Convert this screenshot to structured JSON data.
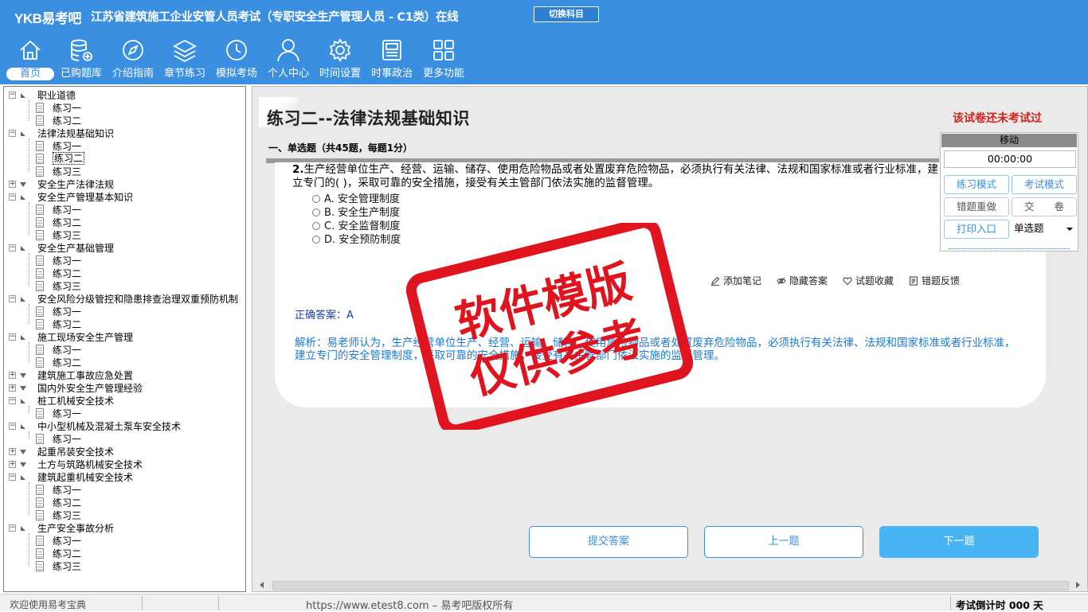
{
  "header": {
    "logo": "YKB易考吧",
    "title": "江苏省建筑施工企业安管人员考试（专职安全生产管理人员 - C1类）在线",
    "switch_label": "切换科目"
  },
  "nav": [
    {
      "label": "首页",
      "icon": "home-icon",
      "active": true
    },
    {
      "label": "已购题库",
      "icon": "database-add-icon"
    },
    {
      "label": "介绍指南",
      "icon": "compass-icon"
    },
    {
      "label": "章节练习",
      "icon": "layers-icon"
    },
    {
      "label": "模拟考场",
      "icon": "clock-icon"
    },
    {
      "label": "个人中心",
      "icon": "user-icon"
    },
    {
      "label": "时间设置",
      "icon": "gear-icon"
    },
    {
      "label": "时事政治",
      "icon": "news-icon"
    },
    {
      "label": "更多功能",
      "icon": "grid-icon"
    }
  ],
  "tree": [
    {
      "label": "职业道德",
      "expanded": true,
      "children": [
        "练习一",
        "练习二"
      ]
    },
    {
      "label": "法律法规基础知识",
      "expanded": true,
      "children": [
        "练习一",
        "练习二",
        "练习三"
      ],
      "selected_child": 1
    },
    {
      "label": "安全生产法律法规",
      "expanded": false,
      "children": []
    },
    {
      "label": "安全生产管理基本知识",
      "expanded": true,
      "children": [
        "练习一",
        "练习二",
        "练习三"
      ]
    },
    {
      "label": "安全生产基础管理",
      "expanded": true,
      "children": [
        "练习一",
        "练习二",
        "练习三"
      ]
    },
    {
      "label": "安全风险分级管控和隐患排查治理双重预防机制",
      "expanded": true,
      "children": [
        "练习一",
        "练习二"
      ]
    },
    {
      "label": "施工现场安全生产管理",
      "expanded": true,
      "children": [
        "练习一",
        "练习二"
      ]
    },
    {
      "label": "建筑施工事故应急处置",
      "expanded": false,
      "children": []
    },
    {
      "label": "国内外安全生产管理经验",
      "expanded": false,
      "children": []
    },
    {
      "label": "桩工机械安全技术",
      "expanded": true,
      "children": [
        "练习一"
      ]
    },
    {
      "label": "中小型机械及混凝土泵车安全技术",
      "expanded": true,
      "children": [
        "练习一"
      ]
    },
    {
      "label": "起重吊装安全技术",
      "expanded": false,
      "children": []
    },
    {
      "label": "土方与筑路机械安全技术",
      "expanded": false,
      "children": []
    },
    {
      "label": "建筑起重机械安全技术",
      "expanded": true,
      "children": [
        "练习一",
        "练习二",
        "练习三"
      ]
    },
    {
      "label": "生产安全事故分析",
      "expanded": true,
      "children": [
        "练习一",
        "练习二",
        "练习三"
      ]
    }
  ],
  "paper": {
    "title": "练习二--法律法规基础知识",
    "status": "该试卷还未考试过",
    "section": "一、单选题（共45题，每题1分）"
  },
  "question": {
    "number": "2.",
    "text": "生产经营单位生产、经营、运输、储存、使用危险物品或者处置废弃危险物品，必须执行有关法律、法规和国家标准或者行业标准，建立专门的( )，采取可靠的安全措施，接受有关主管部门依法实施的监督管理。",
    "options": [
      "A. 安全管理制度",
      "B. 安全生产制度",
      "C. 安全监督制度",
      "D. 安全预防制度"
    ],
    "selected": null
  },
  "tools": [
    {
      "label": "添加笔记",
      "icon": "pencil-icon"
    },
    {
      "label": "隐藏答案",
      "icon": "eye-icon"
    },
    {
      "label": "试题收藏",
      "icon": "heart-icon"
    },
    {
      "label": "错题反馈",
      "icon": "feedback-icon"
    }
  ],
  "answer": {
    "label": "正确答案：",
    "value": "A"
  },
  "analysis": "解析：易老师认为，生产经营单位生产、经营、运输、储存、使用危险物品或者处置废弃危险物品，必须执行有关法律、法规和国家标准或者行业标准，建立专门的安全管理制度，采取可靠的安全措施，接受有关主管部门依法实施的监督管理。",
  "panel": {
    "head": "移动",
    "timer": "00:00:00",
    "practice_mode": "练习模式",
    "exam_mode": "考试模式",
    "redo_wrong": "错题重做",
    "submit_paper": "交　　卷",
    "print": "打印入口",
    "type_select": "单选题"
  },
  "buttons": {
    "submit": "提交答案",
    "prev": "上一题",
    "next": "下一题"
  },
  "statusbar": {
    "welcome": "欢迎使用易考宝典",
    "url": "https://www.etest8.com – 易考吧版权所有",
    "countdown": "考试倒计时 000 天"
  },
  "stamp": {
    "line1": "软件模版",
    "line2": "仅供参考",
    "color": "#e0141e"
  },
  "colors": {
    "header": "#3a8fe0",
    "status_red": "#d3201a",
    "analysis_blue": "#1a7ad0",
    "next_button": "#48b4f4"
  }
}
